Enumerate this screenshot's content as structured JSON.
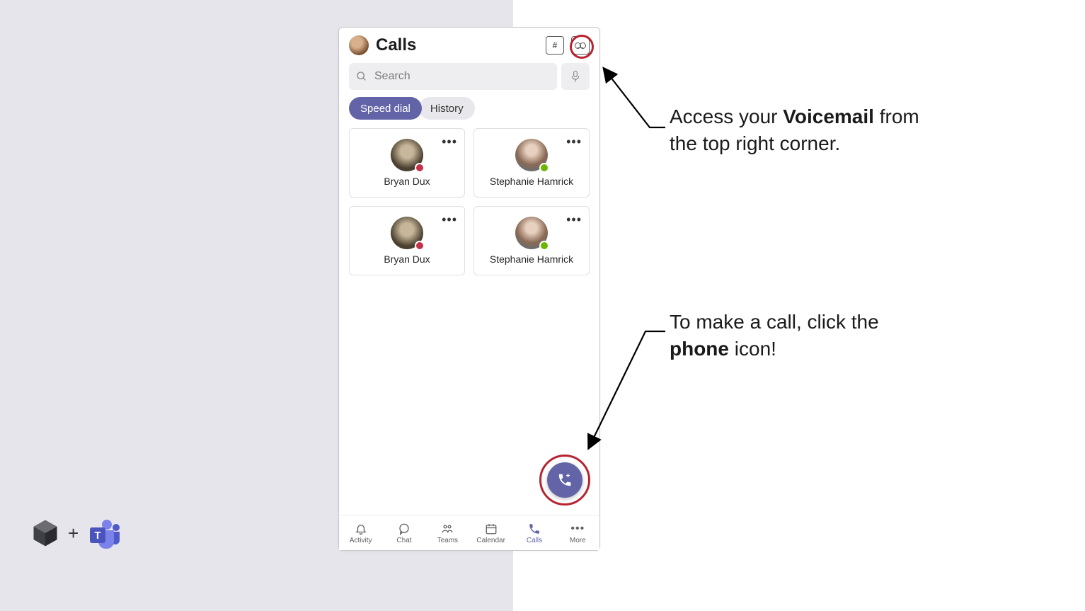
{
  "phone": {
    "title": "Calls",
    "search_placeholder": "Search",
    "tabs": {
      "speed_dial": "Speed dial",
      "history": "History"
    },
    "contacts": [
      {
        "name": "Bryan Dux",
        "presence": "busy"
      },
      {
        "name": "Stephanie Hamrick",
        "presence": "available"
      },
      {
        "name": "Bryan Dux",
        "presence": "busy"
      },
      {
        "name": "Stephanie Hamrick",
        "presence": "available"
      }
    ],
    "nav": {
      "activity": "Activity",
      "chat": "Chat",
      "teams": "Teams",
      "calendar": "Calendar",
      "calls": "Calls",
      "more": "More"
    }
  },
  "callouts": {
    "voicemail_pre": "Access your ",
    "voicemail_bold": "Voicemail",
    "voicemail_post": " from the top right corner.",
    "phone_pre": "To make a call, click the ",
    "phone_bold": "phone",
    "phone_post": " icon!"
  },
  "logo_plus": "+"
}
